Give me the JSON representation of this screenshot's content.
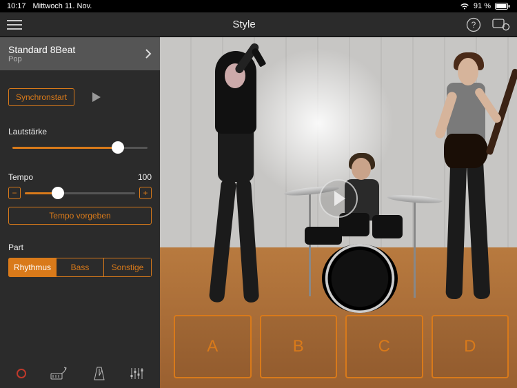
{
  "status": {
    "time": "10:17",
    "date": "Mittwoch 11. Nov.",
    "battery": "91 %"
  },
  "header": {
    "title": "Style"
  },
  "preset": {
    "name": "Standard 8Beat",
    "genre": "Pop"
  },
  "controls": {
    "sync_label": "Synchronstart",
    "volume_label": "Lautstärke",
    "volume_percent": 78,
    "tempo_label": "Tempo",
    "tempo_value": "100",
    "tempo_percent": 30,
    "minus": "−",
    "plus": "+",
    "tap_tempo_label": "Tempo vorgeben"
  },
  "part": {
    "label": "Part",
    "options": [
      "Rhythmus",
      "Bass",
      "Sonstige"
    ],
    "active_index": 0
  },
  "markers": [
    "A",
    "B",
    "C",
    "D"
  ]
}
